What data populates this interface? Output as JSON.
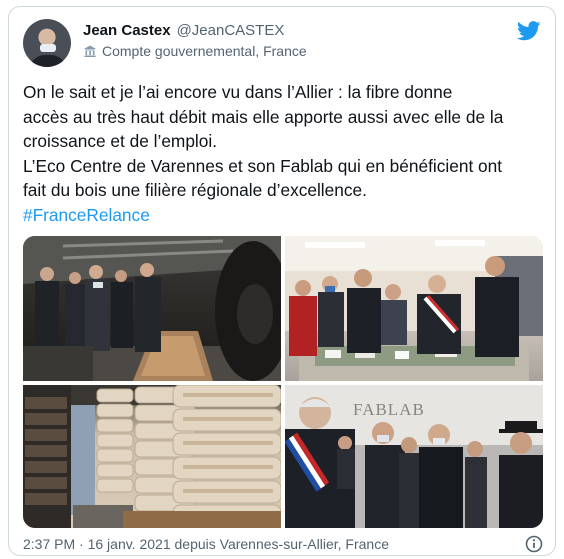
{
  "author": {
    "display_name": "Jean Castex",
    "handle": "@JeanCASTEX",
    "account_label": "Compte gouvernemental, France"
  },
  "tweet": {
    "lines": [
      "On le sait et je l’ai encore vu dans l’Allier : la fibre donne",
      "accès au très haut débit mais elle apporte aussi avec elle de la",
      "croissance et de l’emploi.",
      "L’Eco Centre de Varennes et son Fablab qui en bénéficient ont",
      "fait du bois une filière régionale d’excellence."
    ],
    "hashtag": "#FranceRelance"
  },
  "media": {
    "photo4_sign": "FABLAB"
  },
  "footer": {
    "meta": "2:37 PM · 16 janv. 2021 depuis Varennes-sur-Allier, France"
  },
  "colors": {
    "accent": "#1d9bf0",
    "text": "#0f1419",
    "secondary": "#536471",
    "border": "#cfd9de"
  },
  "icons": {
    "brand": "twitter-bird-icon",
    "account_label": "government-building-icon",
    "info": "info-icon"
  }
}
